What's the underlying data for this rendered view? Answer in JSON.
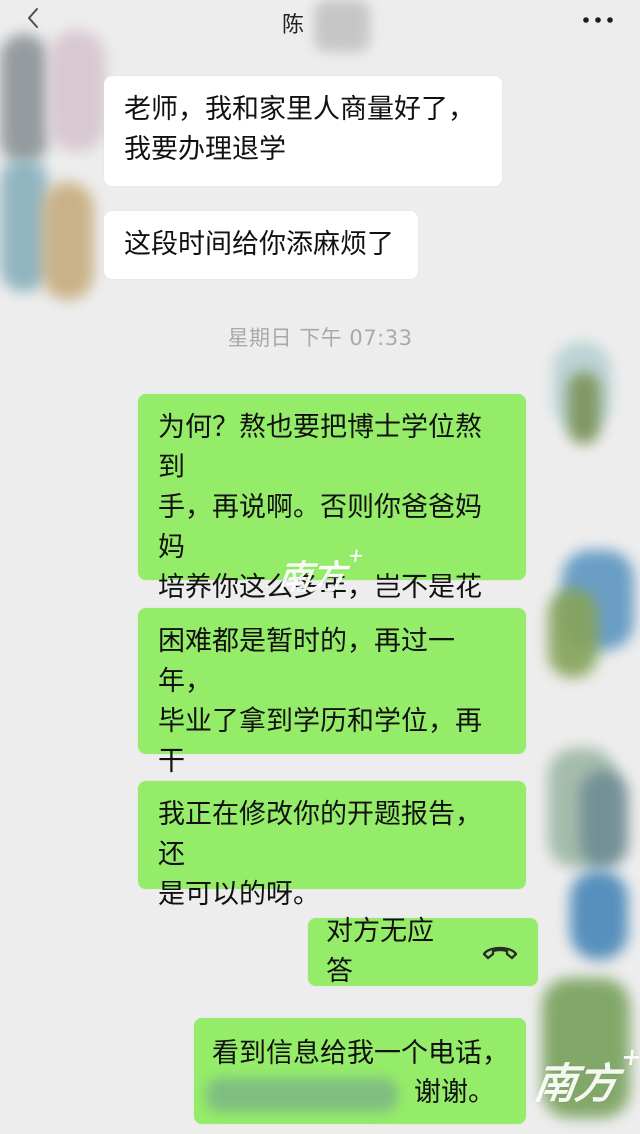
{
  "header": {
    "title": "陈"
  },
  "messages": {
    "m1": "老师，我和家里人商量好了，\n我要办理退学",
    "m2": "这段时间给你添麻烦了",
    "m3": "为何？熬也要把博士学位熬到\n手，再说啊。否则你爸爸妈妈\n培养你这么多年，岂不是花下\n的时间精力都打了水票吗！",
    "m4": "困难都是暂时的，再过一年，\n毕业了拿到学历和学位，再干\n什么就会好办很多。",
    "m5": "我正在修改你的开题报告，还\n是可以的呀。",
    "m6": "对方无应答",
    "m7": "看到信息给我一个电话，",
    "m8": "谢谢。"
  },
  "time_divider": "星期日 下午 07:33",
  "watermarks": {
    "mid": "南方",
    "bottom": "南方"
  },
  "icons": {
    "back": "chevron-left-icon",
    "more": "more-horizontal-icon",
    "call": "phone-hangup-icon"
  }
}
